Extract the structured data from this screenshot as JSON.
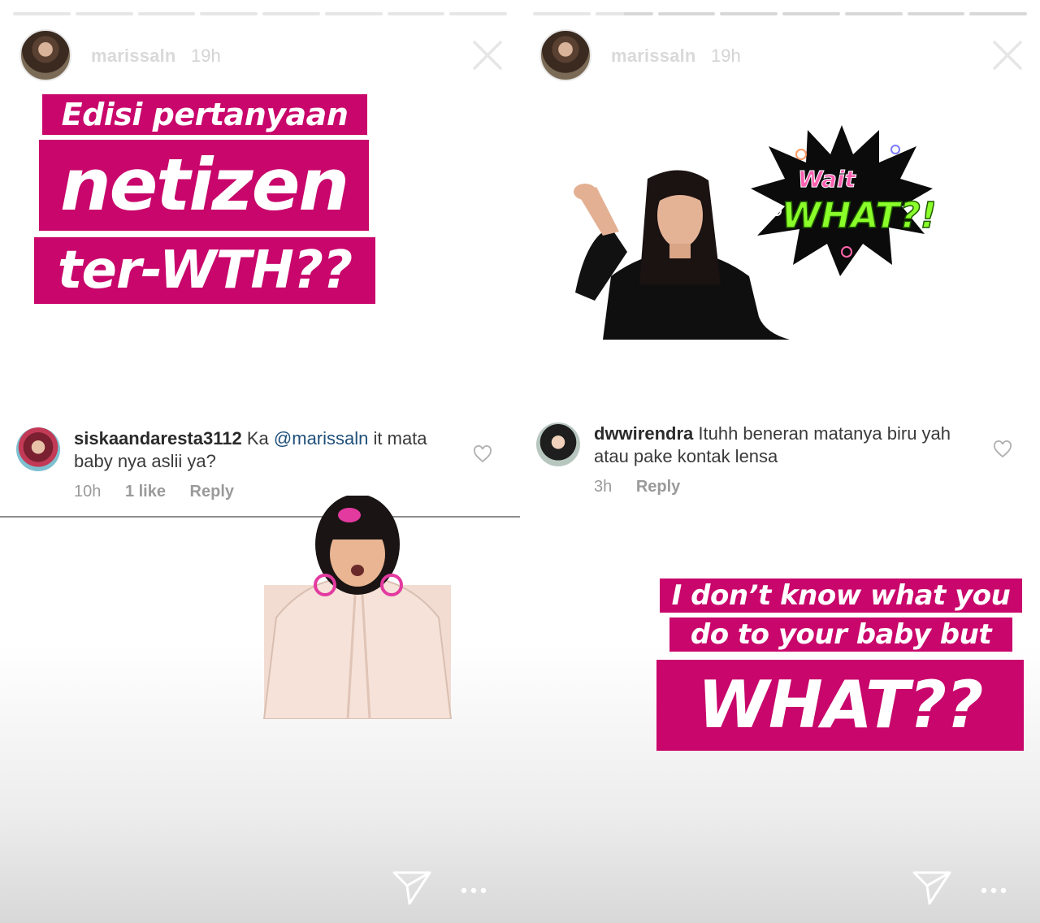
{
  "stories": [
    {
      "progress": [
        1,
        1,
        1,
        1,
        1,
        1,
        1,
        1
      ],
      "user": {
        "name": "marissaln",
        "time": "19h"
      },
      "captions": [
        "Edisi pertanyaan",
        "netizen",
        "ter-WTH??"
      ],
      "comment": {
        "username": "siskaandaresta3112",
        "text_before": "Ka",
        "mention": "@marissaln",
        "text_after": "it mata baby nya aslii ya?",
        "time": "10h",
        "likes": "1 like",
        "reply": "Reply"
      }
    },
    {
      "progress": [
        1,
        0.5,
        0,
        0,
        0,
        0,
        0,
        0
      ],
      "user": {
        "name": "marissaln",
        "time": "19h"
      },
      "sticker_text": [
        "Wait",
        "WHAT?!"
      ],
      "comment": {
        "username": "dwwirendra",
        "text": "Ituhh beneran matanya biru yah atau pake kontak lensa",
        "time": "3h",
        "reply": "Reply"
      },
      "captions": [
        "I don’t know what you",
        "do to your baby but",
        "WHAT??"
      ]
    }
  ],
  "colors": {
    "caption_bg": "#c8066b",
    "caption_text": "#ffffff",
    "sticker_green": "#8aff2a"
  },
  "icons": [
    "close-icon",
    "heart-icon",
    "send-icon",
    "more-icon"
  ]
}
